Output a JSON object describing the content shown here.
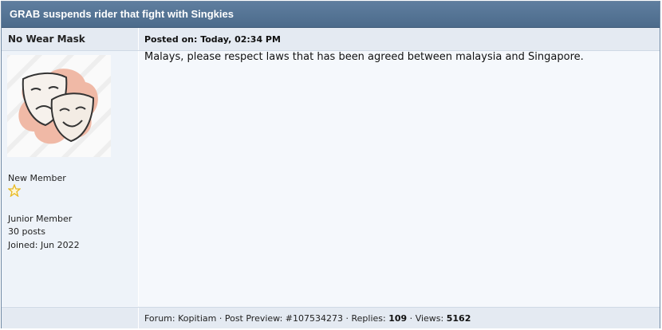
{
  "thread": {
    "title": "GRAB suspends rider that fight with Singkies"
  },
  "post": {
    "author": "No Wear Mask",
    "posted_on": "Posted on: Today, 02:34 PM",
    "content": "Malays, please respect laws that has been agreed between malaysia and Singapore."
  },
  "user": {
    "avatar_icon": "theater-masks-icon",
    "rank": "New Member",
    "rank_icon": "star-outline-icon",
    "title": "Junior Member",
    "posts": "30 posts",
    "joined": "Joined: Jun 2022"
  },
  "footer": {
    "forum_prefix": "Forum: ",
    "forum_name": "Kopitiam",
    "sep1": " · ",
    "preview_prefix": "Post Preview: ",
    "post_id": "#107534273",
    "sep2": " · ",
    "replies_label": "Replies: ",
    "replies": "109",
    "sep3": " · ",
    "views_label": "Views: ",
    "views": "5162"
  },
  "colors": {
    "title_bar": "#4c6b8b",
    "header_bg": "#e4eaf2",
    "body_bg": "#f5f8fc",
    "sidebar_bg": "#eef3f9",
    "star": "#e8b923"
  }
}
